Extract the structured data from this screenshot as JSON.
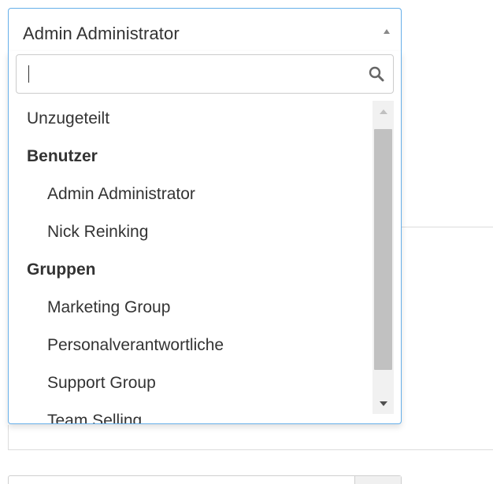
{
  "select": {
    "selected_value": "Admin Administrator"
  },
  "search": {
    "value": "",
    "icon": "search-icon"
  },
  "results": {
    "unassigned": "Unzugeteilt",
    "groups": [
      {
        "label": "Benutzer",
        "options": [
          "Admin Administrator",
          "Nick Reinking"
        ]
      },
      {
        "label": "Gruppen",
        "options": [
          "Marketing Group",
          "Personalverantwortliche",
          "Support Group",
          "Team Selling"
        ]
      }
    ]
  },
  "colors": {
    "focus_border": "#66afe9",
    "text": "#333333",
    "scroll_thumb": "#c1c1c1",
    "scroll_track": "#f1f1f1"
  }
}
